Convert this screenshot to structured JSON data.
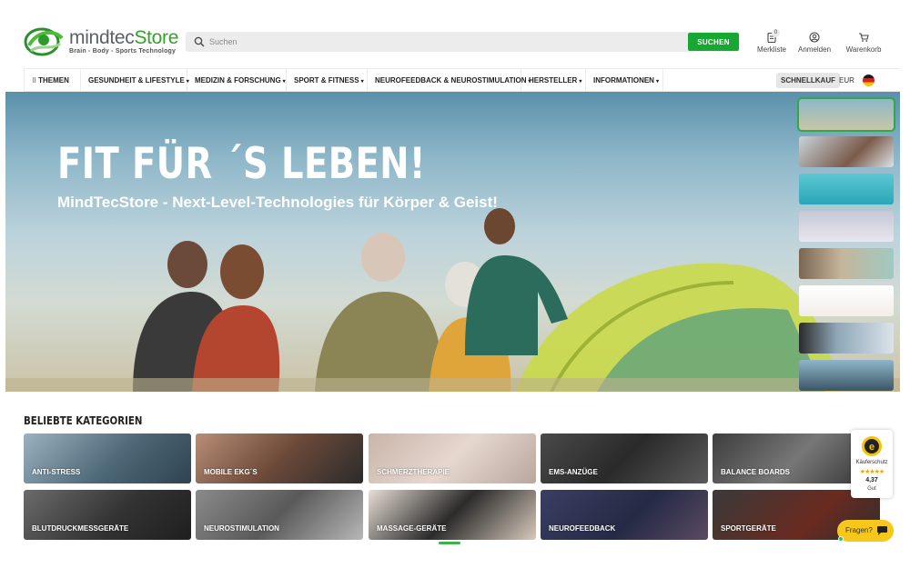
{
  "brand": {
    "name_part1": "mindtec",
    "name_part2": "Store",
    "tagline": "Brain - Body - Sports Technology",
    "green": "#34a12d",
    "accent": "#17a833"
  },
  "search": {
    "placeholder": "Suchen",
    "button_label": "SUCHEN"
  },
  "header_actions": {
    "wishlist_label": "Merkliste",
    "wishlist_count": "0",
    "login_label": "Anmelden",
    "cart_label": "Warenkorb"
  },
  "nav": {
    "items": [
      {
        "label": "THEMEN"
      },
      {
        "label": "GESUNDHEIT & LIFESTYLE"
      },
      {
        "label": "MEDIZIN & FORSCHUNG"
      },
      {
        "label": "SPORT & FITNESS"
      },
      {
        "label": "NEUROFEEDBACK & NEUROSTIMULATION"
      },
      {
        "label": "HERSTELLER"
      },
      {
        "label": "INFORMATIONEN"
      }
    ],
    "quick_buy": "SCHNELLKAUF",
    "currency": "EUR"
  },
  "hero": {
    "title": "FIT FÜR ´S LEBEN!",
    "subtitle": "MindTecStore - Next-Level-Technologies für Körper & Geist!"
  },
  "categories": {
    "title": "BELIEBTE KATEGORIEN",
    "items": [
      {
        "label": "ANTI-STRESS"
      },
      {
        "label": "MOBILE EKG´S"
      },
      {
        "label": "SCHMERZTHERAPIE"
      },
      {
        "label": "EMS-ANZÜGE"
      },
      {
        "label": "BALANCE BOARDS"
      },
      {
        "label": "BLUTDRUCKMESSGERÄTE"
      },
      {
        "label": "NEUROSTIMULATION"
      },
      {
        "label": "MASSAGE-GERÄTE"
      },
      {
        "label": "NEUROFEEDBACK"
      },
      {
        "label": "SPORTGERÄTE"
      }
    ]
  },
  "trust_badge": {
    "label": "Käuferschutz",
    "stars": "★★★★★",
    "score": "4,37",
    "grade": "Gut"
  },
  "chat": {
    "label": "Fragen?"
  }
}
